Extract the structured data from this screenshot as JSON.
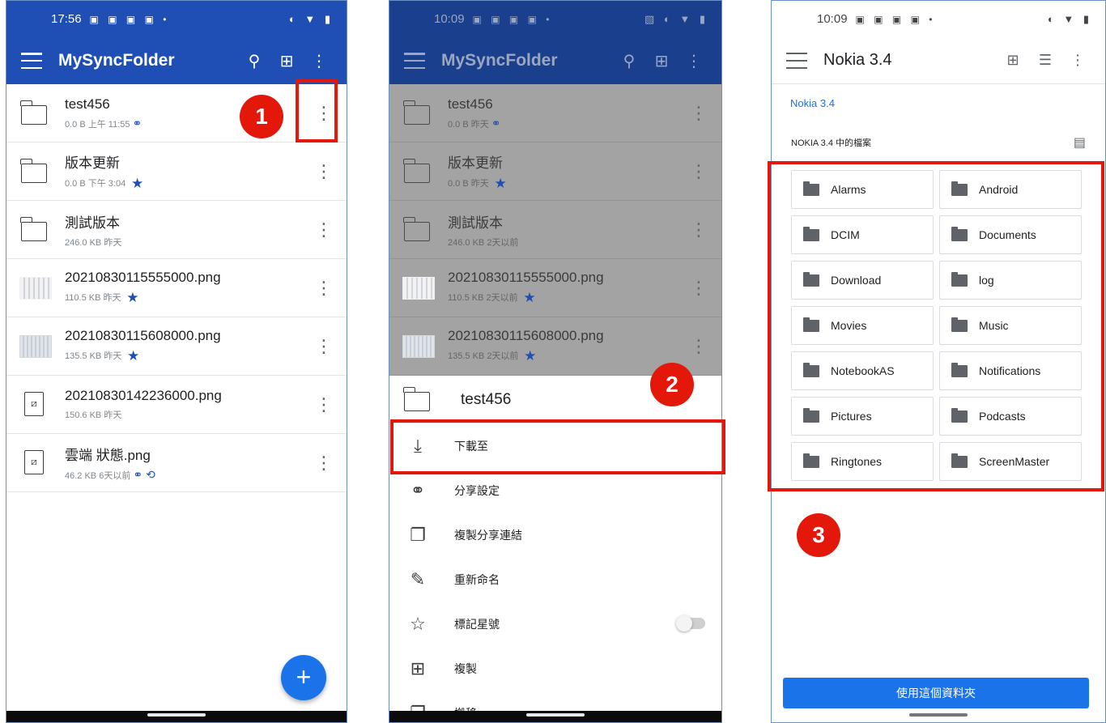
{
  "phone1": {
    "status": {
      "time": "17:56",
      "icons": "▣ ▣ ▣ ▣ •",
      "right": "◐ ▼ ▮"
    },
    "appbar": {
      "title": "MySyncFolder",
      "search_icon": "⚲",
      "grid_icon": "⊞",
      "more_icon": "⋮"
    },
    "rows": [
      {
        "name": "test456",
        "meta": "0.0 B  上午 11:55",
        "type": "folder",
        "flags": [
          "link"
        ]
      },
      {
        "name": "版本更新",
        "meta": "0.0 B  下午 3:04",
        "type": "folder",
        "flags": [
          "star"
        ]
      },
      {
        "name": "測試版本",
        "meta": "246.0 KB  昨天",
        "type": "folder",
        "flags": []
      },
      {
        "name": "20210830115555000.png",
        "meta": "110.5 KB  昨天",
        "type": "thumb-light",
        "flags": [
          "star"
        ]
      },
      {
        "name": "20210830115608000.png",
        "meta": "135.5 KB  昨天",
        "type": "thumb",
        "flags": [
          "star"
        ]
      },
      {
        "name": "20210830142236000.png",
        "meta": "150.6 KB  昨天",
        "type": "image",
        "flags": []
      },
      {
        "name": "雲端 狀態.png",
        "meta": "46.2 KB  6天以前",
        "type": "image",
        "flags": [
          "link",
          "clock"
        ]
      }
    ],
    "fab_label": "+",
    "badge": "1"
  },
  "phone2": {
    "status": {
      "time": "10:09",
      "icons": "▣ ▣ ▣ ▣ •",
      "right": "▧ ◐ ▼ ▮"
    },
    "appbar": {
      "title": "MySyncFolder",
      "search_icon": "⚲",
      "grid_icon": "⊞",
      "more_icon": "⋮"
    },
    "rows": [
      {
        "name": "test456",
        "meta": "0.0 B  昨天",
        "type": "folder",
        "flags": [
          "link"
        ]
      },
      {
        "name": "版本更新",
        "meta": "0.0 B  昨天",
        "type": "folder",
        "flags": [
          "star"
        ]
      },
      {
        "name": "測試版本",
        "meta": "246.0 KB  2天以前",
        "type": "folder",
        "flags": []
      },
      {
        "name": "20210830115555000.png",
        "meta": "110.5 KB  2天以前",
        "type": "thumb-light",
        "flags": [
          "star"
        ]
      },
      {
        "name": "20210830115608000.png",
        "meta": "135.5 KB  2天以前",
        "type": "thumb",
        "flags": [
          "star"
        ]
      }
    ],
    "sheet": {
      "title": "test456",
      "items": [
        {
          "label": "下載至",
          "icon": "⤓"
        },
        {
          "label": "分享設定",
          "icon": "⚭"
        },
        {
          "label": "複製分享連結",
          "icon": "❐"
        },
        {
          "label": "重新命名",
          "icon": "✎"
        },
        {
          "label": "標記星號",
          "icon": "☆"
        },
        {
          "label": "複製",
          "icon": "⊞"
        },
        {
          "label": "搬移",
          "icon": "❐"
        }
      ]
    },
    "badge": "2"
  },
  "phone3": {
    "status": {
      "time": "10:09",
      "icons": "▣ ▣ ▣ ▣ •",
      "right": "◐ ▼ ▮"
    },
    "appbar": {
      "title": "Nokia 3.4",
      "newfolder_icon": "⊞",
      "sort_icon": "☰",
      "more_icon": "⋮"
    },
    "breadcrumb": "Nokia 3.4",
    "section_label": "NOKIA 3.4 中的檔案",
    "view_icon": "▤",
    "folders": [
      "Alarms",
      "Android",
      "DCIM",
      "Documents",
      "Download",
      "log",
      "Movies",
      "Music",
      "NotebookAS",
      "Notifications",
      "Pictures",
      "Podcasts",
      "Ringtones",
      "ScreenMaster"
    ],
    "use_button": "使用這個資料夾",
    "badge": "3"
  },
  "colors": {
    "brand": "#1f4fb5",
    "accent": "#1a73e8",
    "highlight": "#e3180a"
  }
}
